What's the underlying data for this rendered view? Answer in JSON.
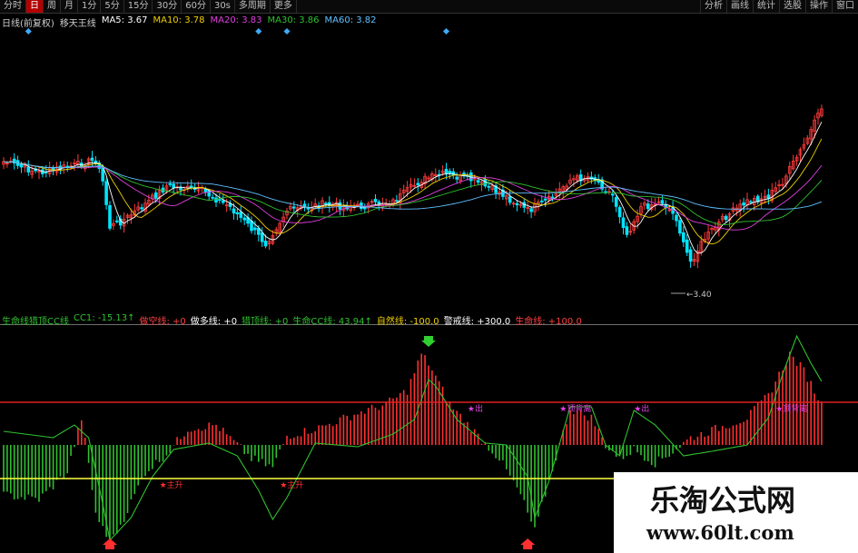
{
  "toolbar": {
    "left_items": [
      {
        "label": "分时",
        "active": false
      },
      {
        "label": "日",
        "active": true
      },
      {
        "label": "周",
        "active": false
      },
      {
        "label": "月",
        "active": false
      },
      {
        "label": "1分",
        "active": false
      },
      {
        "label": "5分",
        "active": false
      },
      {
        "label": "15分",
        "active": false
      },
      {
        "label": "30分",
        "active": false
      },
      {
        "label": "60分",
        "active": false
      },
      {
        "label": "30s",
        "active": false
      },
      {
        "label": "多周期",
        "active": false
      },
      {
        "label": "更多",
        "active": false
      }
    ],
    "right_items": [
      "分析",
      "画线",
      "统计",
      "选股",
      "操作",
      "窗口"
    ]
  },
  "main_legend": {
    "title": "日线(前复权)",
    "indicator": "移天王线",
    "ma": [
      {
        "label": "MA5: 3.67",
        "color": "#ffffff"
      },
      {
        "label": "MA10: 3.78",
        "color": "#f0d000"
      },
      {
        "label": "MA20: 3.83",
        "color": "#e040e0"
      },
      {
        "label": "MA30: 3.86",
        "color": "#30c030"
      },
      {
        "label": "MA60: 3.82",
        "color": "#60c0ff"
      }
    ]
  },
  "sub_legend": {
    "items": [
      {
        "label": "生命线猎顶CC线",
        "color": "#30c030"
      },
      {
        "label": "CC1: -15.13↑",
        "color": "#30c030"
      },
      {
        "label": "做空线: +0",
        "color": "#ff4040"
      },
      {
        "label": "做多线: +0",
        "color": "#ffffff"
      },
      {
        "label": "猎顶线: +0",
        "color": "#30c030"
      },
      {
        "label": "生命CC线: 43.94↑",
        "color": "#30c030"
      },
      {
        "label": "自然线: -100.0",
        "color": "#f0d000"
      },
      {
        "label": "警戒线: +300.0",
        "color": "#ffffff"
      },
      {
        "label": "生命线: +100.0",
        "color": "#ff4040"
      }
    ]
  },
  "chart_data": {
    "type": "candlestick",
    "low_annotation": "3.40",
    "signal_labels": [
      {
        "text": "主升",
        "x_index": 44
      },
      {
        "text": "主升",
        "x_index": 78
      },
      {
        "text": "出",
        "x_index": 131
      },
      {
        "text": "顶背离",
        "x_index": 157
      },
      {
        "text": "出",
        "x_index": 178
      },
      {
        "text": "顶背离",
        "x_index": 218
      }
    ]
  },
  "watermark": {
    "title": "乐淘公式网",
    "url": "www.60lt.com"
  },
  "colors": {
    "up": "#ff3b3b",
    "down": "#00e5ff",
    "sub_up": "#ff3030",
    "sub_down": "#30c030",
    "cc_line": "#30c030",
    "upper_level": "#e02020",
    "lower_level": "#ffff40"
  }
}
